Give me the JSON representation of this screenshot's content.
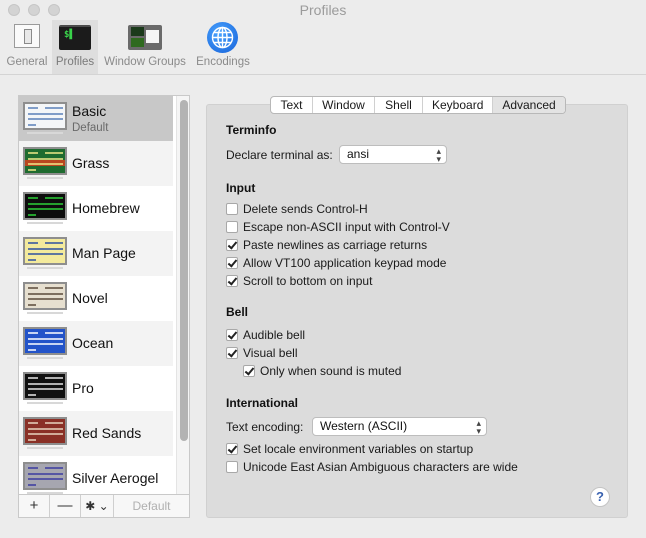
{
  "window": {
    "title": "Profiles"
  },
  "toolbar": {
    "items": [
      {
        "label": "General",
        "icon": "general-switch-icon",
        "selected": false
      },
      {
        "label": "Profiles",
        "icon": "terminal-icon",
        "selected": true,
        "glyph": "$▌"
      },
      {
        "label": "Window Groups",
        "icon": "window-groups-icon",
        "selected": false
      },
      {
        "label": "Encodings",
        "icon": "globe-icon",
        "selected": false
      }
    ]
  },
  "profiles": {
    "items": [
      {
        "name": "Basic",
        "subtitle": "Default",
        "selected": true,
        "bg": "#f4f6f8",
        "fg": "#5a7fb8"
      },
      {
        "name": "Grass",
        "bg": "#1e6b2f",
        "fg": "#f2e98a",
        "band": "#b9461f"
      },
      {
        "name": "Homebrew",
        "bg": "#0d0d0d",
        "fg": "#2ed23a"
      },
      {
        "name": "Man Page",
        "bg": "#f3ea9c",
        "fg": "#2c4fa0"
      },
      {
        "name": "Novel",
        "bg": "#e6dfcf",
        "fg": "#5a4a3a"
      },
      {
        "name": "Ocean",
        "bg": "#2253c9",
        "fg": "#ffffff"
      },
      {
        "name": "Pro",
        "bg": "#111111",
        "fg": "#e8e8e8"
      },
      {
        "name": "Red Sands",
        "bg": "#8a3026",
        "fg": "#e8d5c0"
      },
      {
        "name": "Silver Aerogel",
        "bg": "#a6a6b0",
        "fg": "#3a3aa0"
      }
    ],
    "scroll_fraction_visible": 0.87,
    "tools": {
      "add": "+",
      "remove": "—",
      "gear": "✱ ⌄",
      "default": "Default"
    }
  },
  "tabs": [
    {
      "label": "Text",
      "active": false
    },
    {
      "label": "Window",
      "active": false
    },
    {
      "label": "Shell",
      "active": false
    },
    {
      "label": "Keyboard",
      "active": false
    },
    {
      "label": "Advanced",
      "active": true
    }
  ],
  "advanced": {
    "terminfo": {
      "title": "Terminfo",
      "declare_label": "Declare terminal as:",
      "declare_value": "ansi"
    },
    "input": {
      "title": "Input",
      "options": [
        {
          "label": "Delete sends Control-H",
          "checked": false
        },
        {
          "label": "Escape non-ASCII input with Control-V",
          "checked": false
        },
        {
          "label": "Paste newlines as carriage returns",
          "checked": true
        },
        {
          "label": "Allow VT100 application keypad mode",
          "checked": true
        },
        {
          "label": "Scroll to bottom on input",
          "checked": true
        }
      ]
    },
    "bell": {
      "title": "Bell",
      "options": [
        {
          "label": "Audible bell",
          "checked": true
        },
        {
          "label": "Visual bell",
          "checked": true
        },
        {
          "label": "Only when sound is muted",
          "checked": true
        }
      ]
    },
    "international": {
      "title": "International",
      "encoding_label": "Text encoding:",
      "encoding_value": "Western (ASCII)",
      "options": [
        {
          "label": "Set locale environment variables on startup",
          "checked": true
        },
        {
          "label": "Unicode East Asian Ambiguous characters are wide",
          "checked": false
        }
      ]
    },
    "help": "?"
  }
}
